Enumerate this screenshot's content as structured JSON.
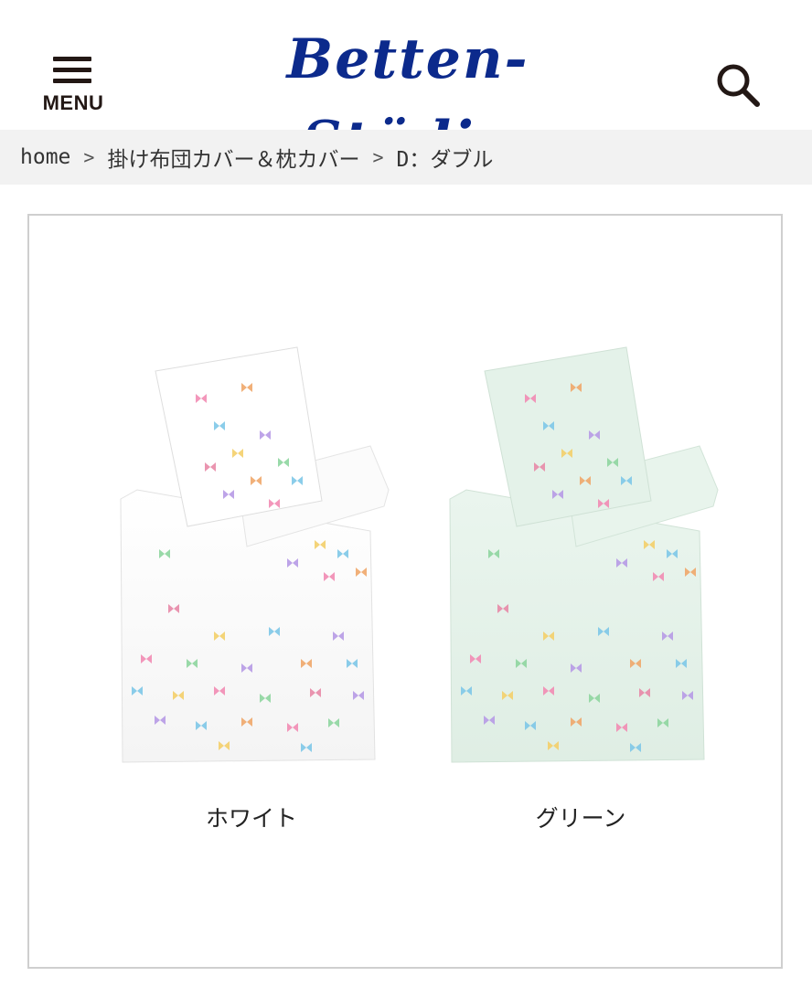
{
  "header": {
    "logo_text": "Betten-Stüdio",
    "menu_label": "MENU",
    "menu_icon": "hamburger-icon",
    "search_icon": "search-icon",
    "logo_color": "#0c2a8c"
  },
  "breadcrumb": {
    "items": [
      {
        "label": "home"
      },
      {
        "label": "掛け布団カバー＆枕カバー"
      },
      {
        "label": "D：ダブル"
      }
    ],
    "separator": ">"
  },
  "product": {
    "variants": [
      {
        "label": "ホワイト",
        "base_color": "#ffffff"
      },
      {
        "label": "グリーン",
        "base_color": "#e6f2ea"
      }
    ]
  }
}
